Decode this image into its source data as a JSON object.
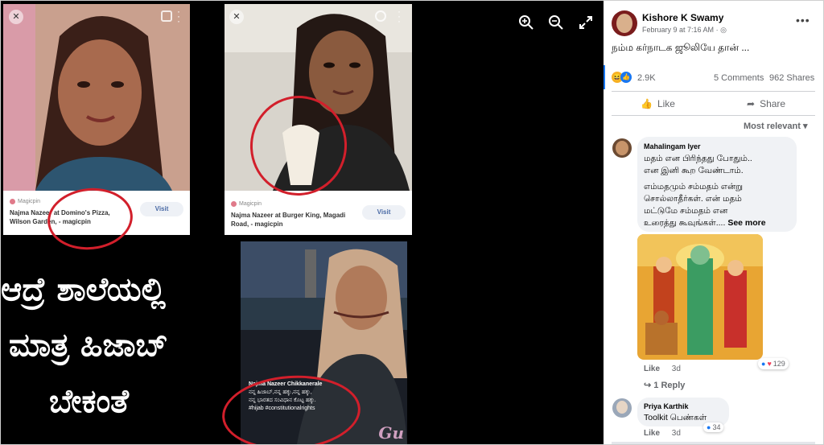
{
  "post": {
    "author": "Kishore K Swamy",
    "date": "February 9 at 7:16 AM",
    "date_sep": "·",
    "text": "நம்ம கர்நாடக ஜூலியே தான் ...",
    "reactions_count": "2.9K",
    "comments": "5 Comments",
    "shares": "962 Shares",
    "like_label": "Like",
    "share_label": "Share",
    "sort_label": "Most relevant",
    "more_icon": "more-dots-icon"
  },
  "comments": [
    {
      "name": "Mahalingam Iyer",
      "text_line1": "மதம் என பிரிந்தது போதும்..",
      "text_line2": "என இனி கூற வேண்டாம்.",
      "text_line3": "எம்மதமும் சம்மதம் என்று",
      "text_line4": "சொல்லாதீர்கள். என் மதம்",
      "text_line5": "மட்டுமே சம்மதம் என",
      "text_line6": "உரைத்து கூவுங்கள்....",
      "see_more": "See more",
      "like": "Like",
      "time": "3d",
      "reactions": "129",
      "replies": "1 Reply"
    },
    {
      "name": "Priya Karthik",
      "text": "Toolkit பெண்கள்",
      "like": "Like",
      "time": "3d",
      "reactions": "34"
    }
  ],
  "image": {
    "card1": {
      "source": "Magicpin",
      "title_line1": "Najma Nazeer at Domino's Pizza,",
      "title_line2": "Wilson Garden, - magicpin",
      "visit": "Visit"
    },
    "card2": {
      "source": "Magicpin",
      "title_line1": "Najma Nazeer at Burger King, Magadi",
      "title_line2": "Road, - magicpin",
      "visit": "Visit"
    },
    "card3": {
      "caption_title": "Najma Nazeer Chikkanerale",
      "caption_line1": "ನನ್ನ ಹಿಜಾಬ್,ನನ್ನ ಹಕ್ಕು,ನನ್ನ ಹಕ್ಕು,",
      "caption_line2": "ನನ್ನ ಭಾರತದ ಸಂವಿಧಾನ ಕೊಟ್ಟ ಹಕ್ಕು.",
      "caption_line3": "#hijab #constitutionalrights",
      "watermark": "Gu"
    },
    "kannada_line1": "ಆದ್ರೆ ಶಾಲೆಯಲ್ಲಿ",
    "kannada_line2": "ಮಾತ್ರ ಹಿಜಾಬ್",
    "kannada_line3": "ಬೇಕಂತೆ"
  },
  "toolbar": {
    "zoom_in": "zoom-in-icon",
    "zoom_out": "zoom-out-icon",
    "fullscreen": "fullscreen-icon"
  },
  "colors": {
    "link": "#385898",
    "red_ring": "#d21f2b",
    "like_blue": "#1877f2"
  }
}
